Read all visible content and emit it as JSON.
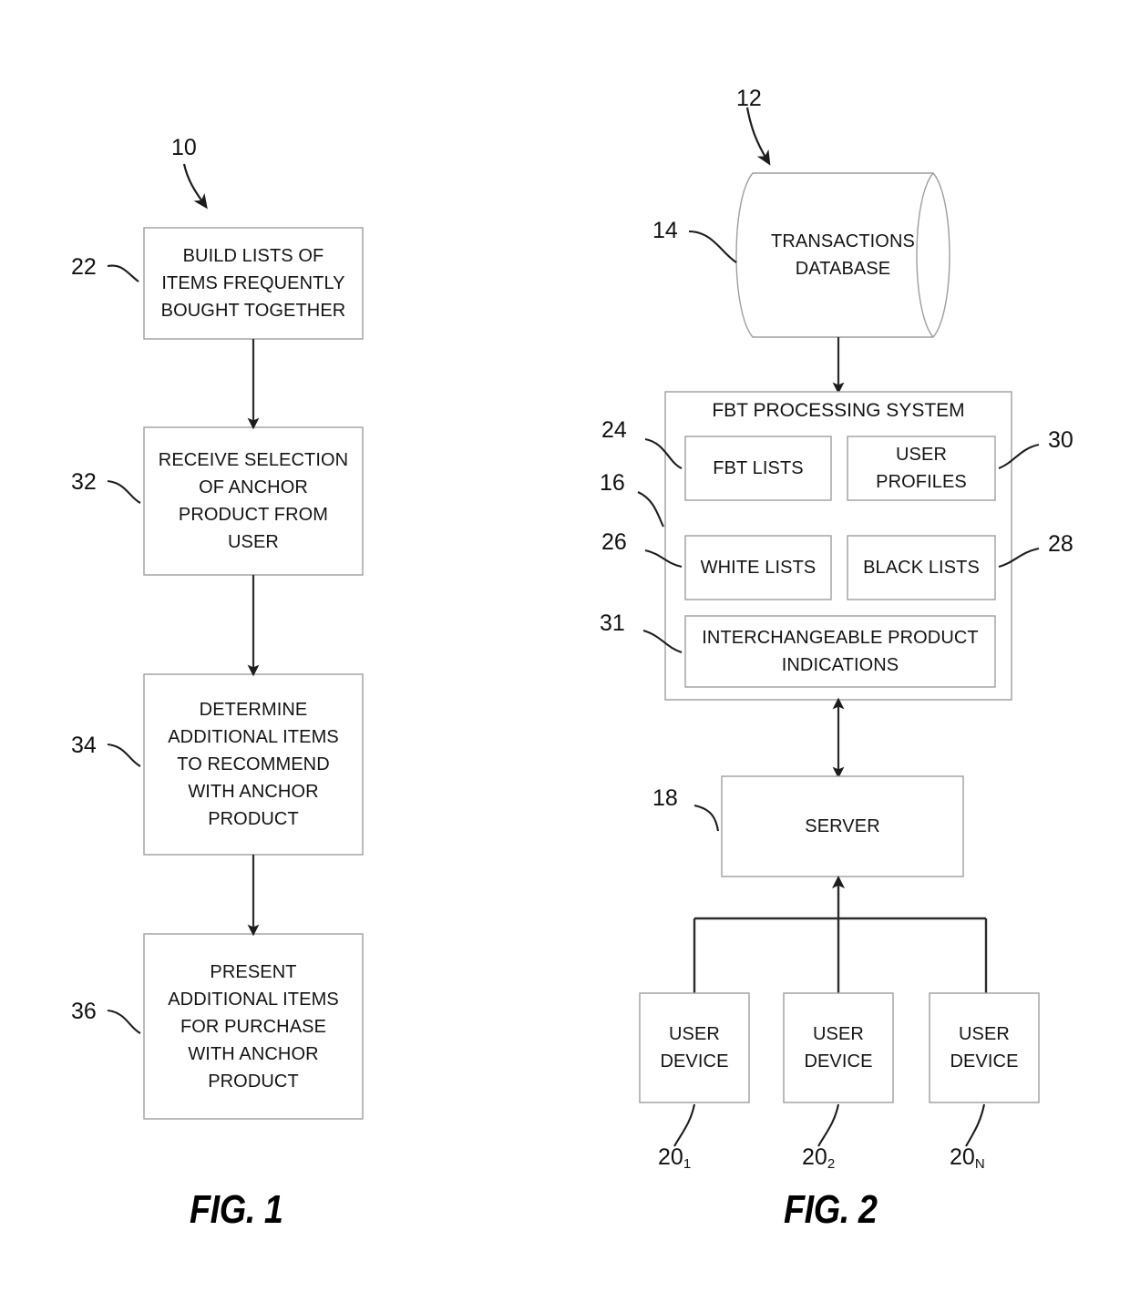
{
  "figure1": {
    "caption": "FIG. 1",
    "top_ref": "10",
    "steps": [
      {
        "ref": "22",
        "text": "BUILD LISTS OF\nITEMS FREQUENTLY\nBOUGHT TOGETHER"
      },
      {
        "ref": "32",
        "text": "RECEIVE SELECTION\nOF ANCHOR\nPRODUCT FROM\nUSER"
      },
      {
        "ref": "34",
        "text": "DETERMINE\nADDITIONAL ITEMS\nTO RECOMMEND\nWITH ANCHOR\nPRODUCT"
      },
      {
        "ref": "36",
        "text": "PRESENT\nADDITIONAL ITEMS\nFOR PURCHASE\nWITH ANCHOR\nPRODUCT"
      }
    ]
  },
  "figure2": {
    "caption": "FIG. 2",
    "top_ref": "12",
    "database": {
      "ref": "14",
      "label": "TRANSACTIONS\nDATABASE"
    },
    "processing_system": {
      "ref": "16",
      "title": "FBT PROCESSING SYSTEM",
      "modules": [
        {
          "ref": "24",
          "label": "FBT LISTS"
        },
        {
          "ref": "30",
          "label": "USER\nPROFILES"
        },
        {
          "ref": "26",
          "label": "WHITE LISTS"
        },
        {
          "ref": "28",
          "label": "BLACK LISTS"
        },
        {
          "ref": "31",
          "label": "INTERCHANGEABLE PRODUCT\nINDICATIONS"
        }
      ]
    },
    "server": {
      "ref": "18",
      "label": "SERVER"
    },
    "user_devices": [
      {
        "ref_base": "20",
        "ref_sub": "1",
        "label": "USER\nDEVICE"
      },
      {
        "ref_base": "20",
        "ref_sub": "2",
        "label": "USER\nDEVICE"
      },
      {
        "ref_base": "20",
        "ref_sub": "N",
        "label": "USER\nDEVICE"
      }
    ]
  },
  "colors": {
    "ink": "#141414",
    "line": "#2b2b2b",
    "box_border": "#9a9a9a",
    "page": "#ffffff"
  }
}
